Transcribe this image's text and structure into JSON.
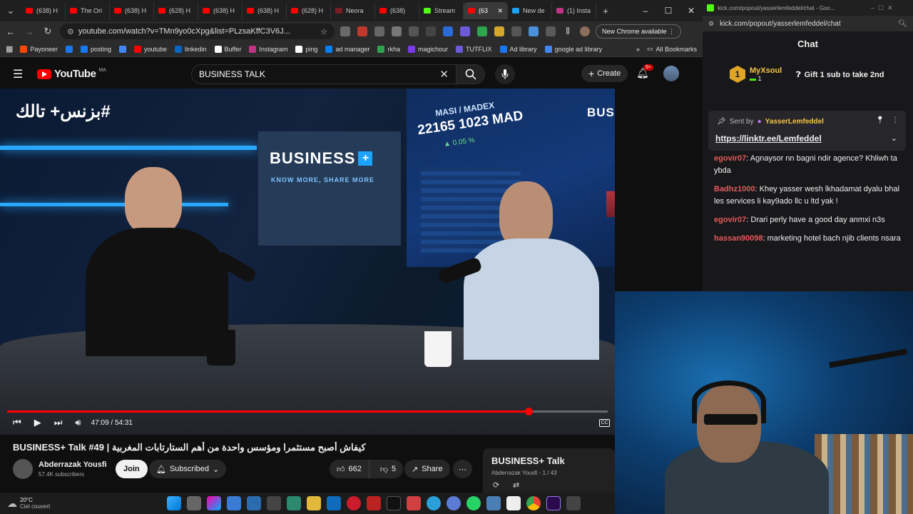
{
  "browser": {
    "tabs": [
      {
        "label": "(638) H",
        "color": "#ff0000"
      },
      {
        "label": "The Ori",
        "color": "#ff0000"
      },
      {
        "label": "(638) H",
        "color": "#ff0000"
      },
      {
        "label": "(628) H",
        "color": "#ff0000"
      },
      {
        "label": "(638) H",
        "color": "#ff0000"
      },
      {
        "label": "(638) H",
        "color": "#ff0000"
      },
      {
        "label": "(628) H",
        "color": "#ff0000"
      },
      {
        "label": "Neora",
        "color": "#7a1c24"
      },
      {
        "label": "(638)",
        "color": "#ff0000"
      },
      {
        "label": "Stream",
        "color": "#53fc18"
      },
      {
        "label": "(63",
        "color": "#ff0000"
      },
      {
        "label": "New de",
        "color": "#1da1f2"
      },
      {
        "label": "(1) Insta",
        "color": "#c13584"
      }
    ],
    "url": "youtube.com/watch?v=TMn9yo0cXpg&list=PLzsaKffC3V6J...",
    "update_label": "New Chrome available",
    "bookmarks": [
      {
        "label": "Payoneer",
        "color": "#ff4800"
      },
      {
        "label": "",
        "color": "#1877f2"
      },
      {
        "label": "posting",
        "color": "#1877f2"
      },
      {
        "label": "",
        "color": "#4285f4"
      },
      {
        "label": "youtube",
        "color": "#ff0000"
      },
      {
        "label": "linkedin",
        "color": "#0a66c2"
      },
      {
        "label": "Buffer",
        "color": "#ffffff"
      },
      {
        "label": "Instagram",
        "color": "#c13584"
      },
      {
        "label": "ping",
        "color": "#ffffff"
      },
      {
        "label": "ad manager",
        "color": "#0081fb"
      },
      {
        "label": "rkha",
        "color": "#2ea44f"
      },
      {
        "label": "magichour",
        "color": "#7c3aed"
      },
      {
        "label": "TUTFLIX",
        "color": "#6b5bd6"
      },
      {
        "label": "Ad library",
        "color": "#1877f2"
      },
      {
        "label": "google ad library",
        "color": "#4285f4"
      }
    ],
    "all_bookmarks": "All Bookmarks"
  },
  "youtube": {
    "logo": "YouTube",
    "region": "MA",
    "search_value": "BUSINESS TALK",
    "create_label": "Create",
    "notif_count": "9+",
    "video": {
      "overlay_arabic": "#بزنس+ تالك",
      "brand": "BUSINESS",
      "brand_tag": "KNOW MORE, SHARE MORE",
      "ticker_label": "MASI / MADEX",
      "ticker_value": "22165 1023 MAD",
      "ticker_change": "▲ 0.05 %",
      "time": "47:09 / 54:31",
      "progress": 0.8677
    },
    "title": "BUSINESS+ Talk #49 | كيفاش أصبح مستثمرا ومؤسس واحدة من أهم الستارتابات المغربية",
    "channel": "Abderrazak Yousfi",
    "subscribers": "57.4K subscribers",
    "join_label": "Join",
    "subscribed_label": "Subscribed",
    "likes": "662",
    "dislikes": "5",
    "share_label": "Share",
    "playlist": {
      "title": "BUSINESS+ Talk",
      "meta": "Abderrazak Yousfi - 1 / 43"
    }
  },
  "kick": {
    "url": "kick.com/popout/yasserlemfeddel/chat",
    "window_title": "kick.com/popout/yasserlemfeddel/chat - Goo...",
    "chat_title": "Chat",
    "top_user": "MyXsoul",
    "top_rank": "1",
    "top_count": "1",
    "gift_label": "Gift 1 sub to take 2nd",
    "pinned_sender_prefix": "Sent by",
    "pinned_sender": "YasserLemfeddel",
    "pinned_link": "https://linktr.ee/Lemfeddel",
    "messages": [
      {
        "user": "egovir07",
        "text": "Agnaysor nn bagni ndir agence? Khliwh ta ybda",
        "color": "#e45a5a"
      },
      {
        "user": "Badhz1000",
        "text": "Khey yasser wesh lkhadamat dyalu bhal les services li kay9ado llc u ltd yak !",
        "color": "#e45a5a"
      },
      {
        "user": "egovir07",
        "text": "Drari perly have a good day anmxi n3s",
        "color": "#e45a5a"
      },
      {
        "user": "hassan90098",
        "text": "marketing hotel bach njib clients nsara",
        "color": "#e45a5a"
      }
    ]
  },
  "taskbar": {
    "weather_temp": "20°C",
    "weather_desc": "Ciel couvert"
  }
}
